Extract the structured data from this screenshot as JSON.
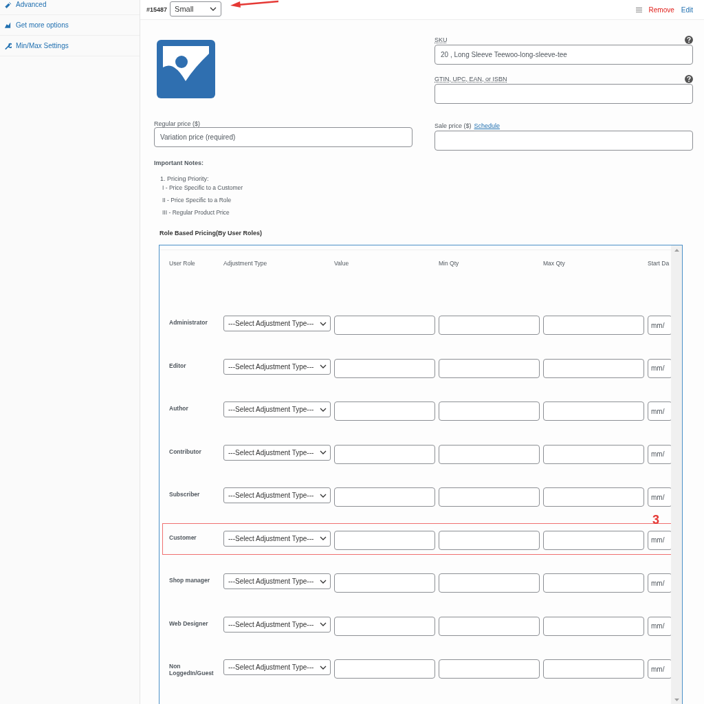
{
  "sidebar": {
    "items": [
      {
        "label": "Advanced"
      },
      {
        "label": "Get more options"
      },
      {
        "label": "Min/Max Settings"
      }
    ]
  },
  "variation": {
    "id": "#15487",
    "attribute": "Small",
    "actions": [
      {
        "label": "Remove",
        "kind": "danger"
      },
      {
        "label": "Edit",
        "kind": "link"
      }
    ]
  },
  "sku": {
    "label": "SKU",
    "value": "20 , Long Sleeve Teewoo-long-sleeve-tee"
  },
  "gtin": {
    "label": "GTIN, UPC, EAN, or ISBN"
  },
  "regular_price": {
    "label": "Regular price ($)",
    "placeholder": "Variation price (required)"
  },
  "sale_price": {
    "label": "Sale price ($)",
    "link": "Schedule"
  },
  "notes": {
    "title": "Important Notes:",
    "heading": "1. Pricing Priority:",
    "items": [
      "I - Price Specific to a Customer",
      "II - Price Specific to a Role",
      "III - Regular Product Price"
    ]
  },
  "role_pricing": {
    "title": "Role Based Pricing(By User Roles)",
    "columns": [
      "User Role",
      "Adjustment Type",
      "Value",
      "Min Qty",
      "Max Qty",
      "Start Da"
    ],
    "rows": [
      {
        "role": "Administrator",
        "adjustment": "---Select Adjustment Type---",
        "date_placeholder": "mm/",
        "highlighted": false
      },
      {
        "role": "Editor",
        "adjustment": "---Select Adjustment Type---",
        "date_placeholder": "mm/",
        "highlighted": false
      },
      {
        "role": "Author",
        "adjustment": "---Select Adjustment Type---",
        "date_placeholder": "mm/",
        "highlighted": false
      },
      {
        "role": "Contributor",
        "adjustment": "---Select Adjustment Type---",
        "date_placeholder": "mm/",
        "highlighted": false
      },
      {
        "role": "Subscriber",
        "adjustment": "---Select Adjustment Type---",
        "date_placeholder": "mm/",
        "highlighted": false
      },
      {
        "role": "Customer",
        "adjustment": "---Select Adjustment Type---",
        "date_placeholder": "mm/",
        "highlighted": true
      },
      {
        "role": "Shop manager",
        "adjustment": "---Select Adjustment Type---",
        "date_placeholder": "mm/",
        "highlighted": false
      },
      {
        "role": "Web Designer",
        "adjustment": "---Select Adjustment Type---",
        "date_placeholder": "mm/",
        "highlighted": false
      },
      {
        "role": "Non LoggedIn/Guest",
        "adjustment": "---Select Adjustment Type---",
        "date_placeholder": "mm/",
        "highlighted": false
      }
    ]
  },
  "annotations": [
    {
      "kind": "arrow"
    },
    {
      "kind": "label",
      "label": "3"
    }
  ]
}
